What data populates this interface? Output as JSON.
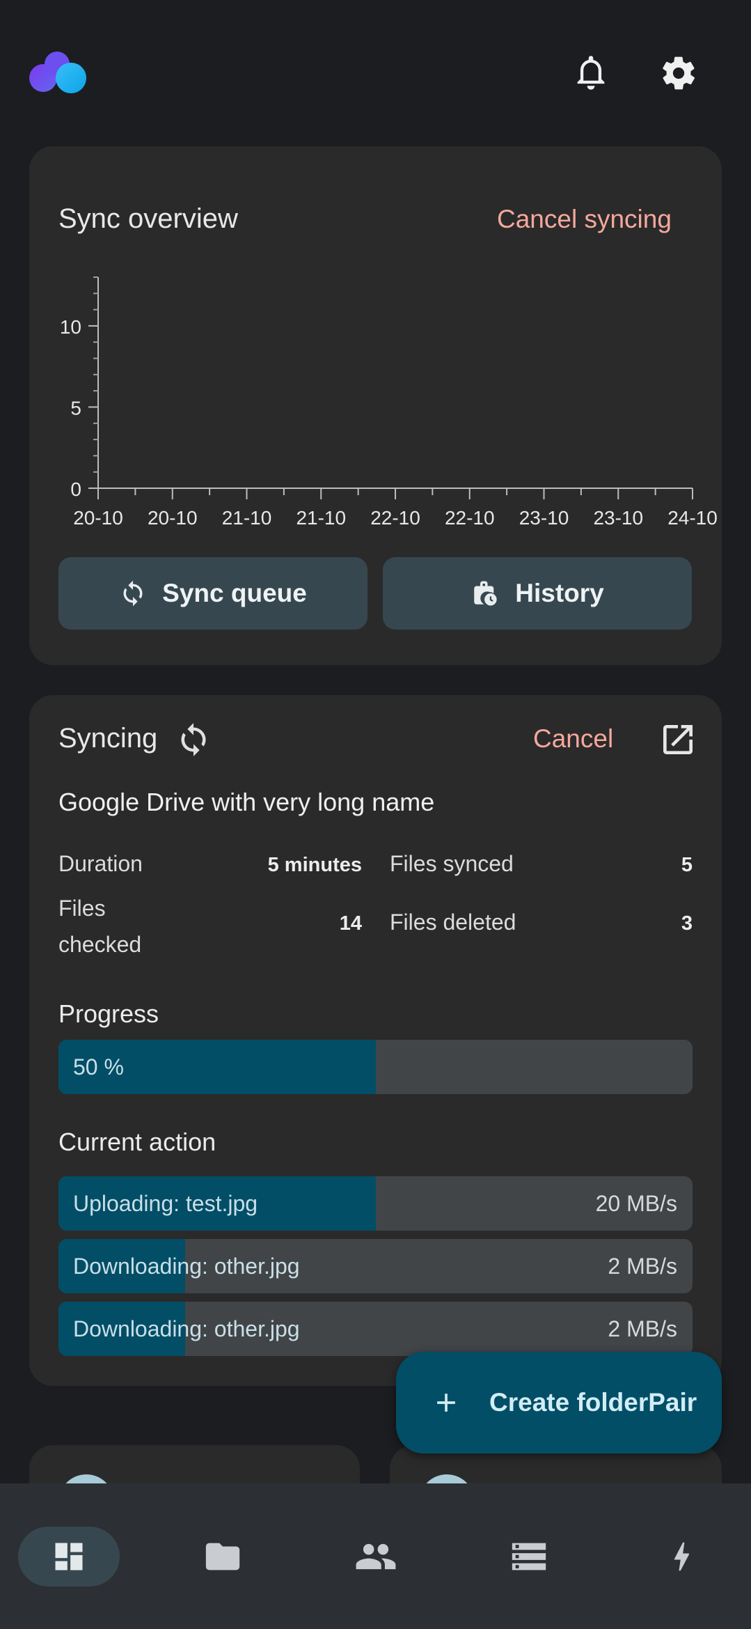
{
  "header": {
    "logo_icon": "app-logo-icon",
    "notifications_icon": "bell-icon",
    "settings_icon": "gear-icon"
  },
  "overview": {
    "title": "Sync overview",
    "cancel_label": "Cancel syncing",
    "sync_queue_label": "Sync queue",
    "history_label": "History"
  },
  "chart_data": {
    "type": "line",
    "title": "",
    "xlabel": "",
    "ylabel": "",
    "x_ticks": [
      "20-10",
      "20-10",
      "21-10",
      "21-10",
      "22-10",
      "22-10",
      "23-10",
      "23-10",
      "24-10"
    ],
    "y_ticks": [
      0,
      5,
      10
    ],
    "ylim": [
      0,
      13
    ],
    "series": [],
    "grid": false
  },
  "syncing": {
    "title": "Syncing",
    "cancel_label": "Cancel",
    "connection_name": "Google Drive with very long name",
    "stats": {
      "duration_label": "Duration",
      "duration_value": "5 minutes",
      "files_synced_label": "Files synced",
      "files_synced_value": "5",
      "files_checked_label": "Files checked",
      "files_checked_value": "14",
      "files_deleted_label": "Files deleted",
      "files_deleted_value": "3"
    },
    "progress_label": "Progress",
    "progress_text": "50 %",
    "progress_fraction": 0.5,
    "current_action_label": "Current action",
    "actions": [
      {
        "text": "Uploading: test.jpg",
        "rate": "20 MB/s",
        "fraction": 0.5
      },
      {
        "text": "Downloading: other.jpg",
        "rate": "2 MB/s",
        "fraction": 0.2
      },
      {
        "text": "Downloading: other.jpg",
        "rate": "2 MB/s",
        "fraction": 0.2
      }
    ]
  },
  "fab": {
    "label": "Create folderPair"
  },
  "colors": {
    "accent_text": "#f5a89c",
    "progress_fill": "#024e66",
    "button_bg": "#37474f",
    "card_bg": "#2a2a2a"
  },
  "nav": {
    "items": [
      {
        "icon": "dashboard-icon",
        "active": true
      },
      {
        "icon": "folder-icon",
        "active": false
      },
      {
        "icon": "people-icon",
        "active": false
      },
      {
        "icon": "storage-icon",
        "active": false
      },
      {
        "icon": "lightning-icon",
        "active": false
      }
    ]
  }
}
